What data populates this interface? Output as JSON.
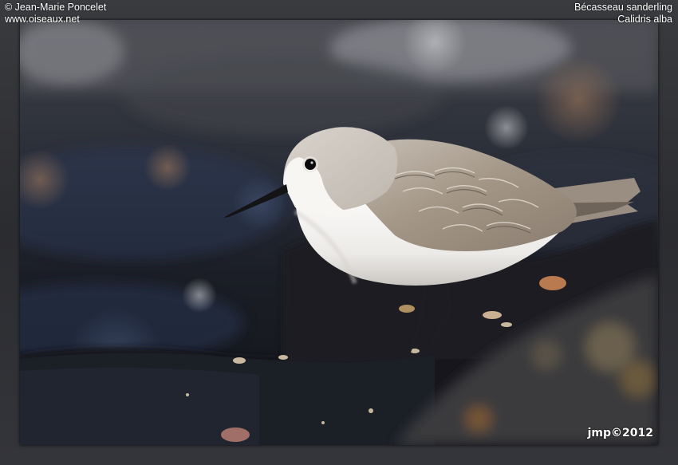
{
  "credits": {
    "author": "© Jean-Marie Poncelet",
    "website": "www.oiseaux.net"
  },
  "species": {
    "common_name": "Bécasseau sanderling",
    "scientific_name": "Calidris alba"
  },
  "signature": "jmp©2012",
  "colors": {
    "frame": "#2e2f33",
    "background_dark": "#1f2229",
    "rock": "#15181d",
    "bird_belly": "#f2f2f0",
    "bird_back": "#a59a90"
  }
}
